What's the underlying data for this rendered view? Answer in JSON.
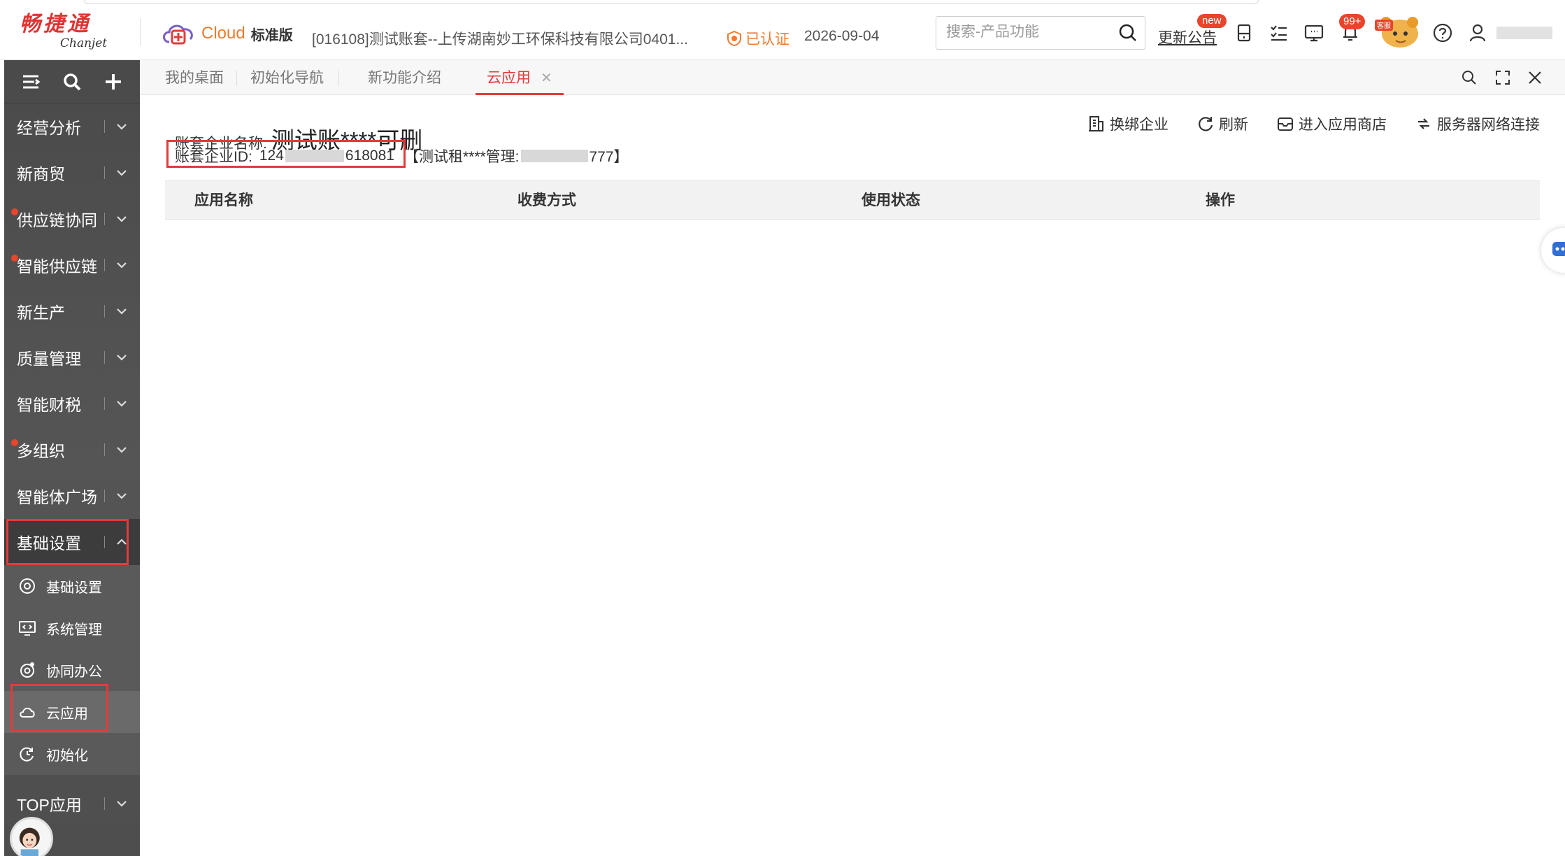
{
  "header": {
    "logo_cn": "畅捷通",
    "logo_en": "Chanjet",
    "cloud_word": "Cloud",
    "edition": "标准版",
    "account_title": "[016108]测试账套--上传湖南妙工环保科技有限公司0401...",
    "certified": "已认证",
    "date": "2026-09-04",
    "search_placeholder": "搜索-产品功能",
    "announcement": "更新公告",
    "new_badge": "new",
    "notif_badge": "99+",
    "kefu_label": "客服"
  },
  "sidebar": {
    "items": [
      {
        "label": "经营分析",
        "dot": false
      },
      {
        "label": "新商贸",
        "dot": false
      },
      {
        "label": "供应链协同",
        "dot": true
      },
      {
        "label": "智能供应链",
        "dot": true
      },
      {
        "label": "新生产",
        "dot": false
      },
      {
        "label": "质量管理",
        "dot": false
      },
      {
        "label": "智能财税",
        "dot": false
      },
      {
        "label": "多组织",
        "dot": true
      },
      {
        "label": "智能体广场",
        "dot": false
      },
      {
        "label": "基础设置",
        "dot": false
      }
    ],
    "sub_items": [
      {
        "label": "基础设置",
        "icon": "settings-icon"
      },
      {
        "label": "系统管理",
        "icon": "monitor-code-icon"
      },
      {
        "label": "协同办公",
        "icon": "collab-icon"
      },
      {
        "label": "云应用",
        "icon": "cloud-icon"
      },
      {
        "label": "初始化",
        "icon": "reset-icon"
      }
    ],
    "top_app": "TOP应用"
  },
  "tabs": [
    {
      "label": "我的桌面"
    },
    {
      "label": "初始化导航"
    },
    {
      "label": "新功能介绍"
    },
    {
      "label": "云应用",
      "active": true
    }
  ],
  "main": {
    "enterprise_label": "账套企业名称:",
    "enterprise_name": "测试账****可删",
    "id_label": "账套企业ID:",
    "id_prefix": "124",
    "id_suffix": "618081",
    "manager_prefix": "【测试租****管理:",
    "manager_suffix": "777】",
    "actions": [
      "换绑企业",
      "刷新",
      "进入应用商店",
      "服务器网络连接"
    ],
    "columns": [
      "应用名称",
      "收费方式",
      "使用状态",
      "操作"
    ]
  },
  "colors": {
    "accent_red": "#e23b3b",
    "brand_orange": "#ef7a2e",
    "sidebar_bg": "#4a4a4a"
  }
}
